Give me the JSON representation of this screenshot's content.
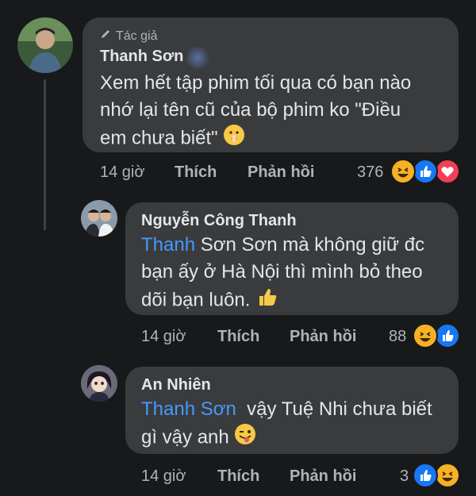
{
  "comments": [
    {
      "badge": "Tác giả",
      "name": "Thanh Sơn",
      "lines": [
        "Xem hết tập phim tối qua có bạn nào",
        "nhớ lại tên cũ của bộ phim ko \"Điều",
        "em chưa biết\""
      ],
      "time": "14 giờ",
      "like": "Thích",
      "reply": "Phản hồi",
      "count": "376"
    },
    {
      "name": "Nguyễn Công Thanh",
      "mention": "Thanh",
      "lines": [
        " Sơn Sơn mà không giữ đc",
        "bạn ấy ở Hà Nội thì mình bỏ theo",
        "dõi bạn luôn."
      ],
      "time": "14 giờ",
      "like": "Thích",
      "reply": "Phản hồi",
      "count": "88"
    },
    {
      "name": "An Nhiên",
      "mention": "Thanh Sơn",
      "lines": [
        "  vậy Tuệ Nhi chưa biết",
        "gì vậy anh"
      ],
      "time": "14 giờ",
      "like": "Thích",
      "reply": "Phản hồi",
      "count": "3"
    }
  ],
  "colors": {
    "background": "#18191a",
    "bubble": "#3a3b3c",
    "mention": "#4599ff",
    "like_blue": "#1877f2",
    "love_red": "#f33e58",
    "haha_yellow": "#f7b125"
  }
}
